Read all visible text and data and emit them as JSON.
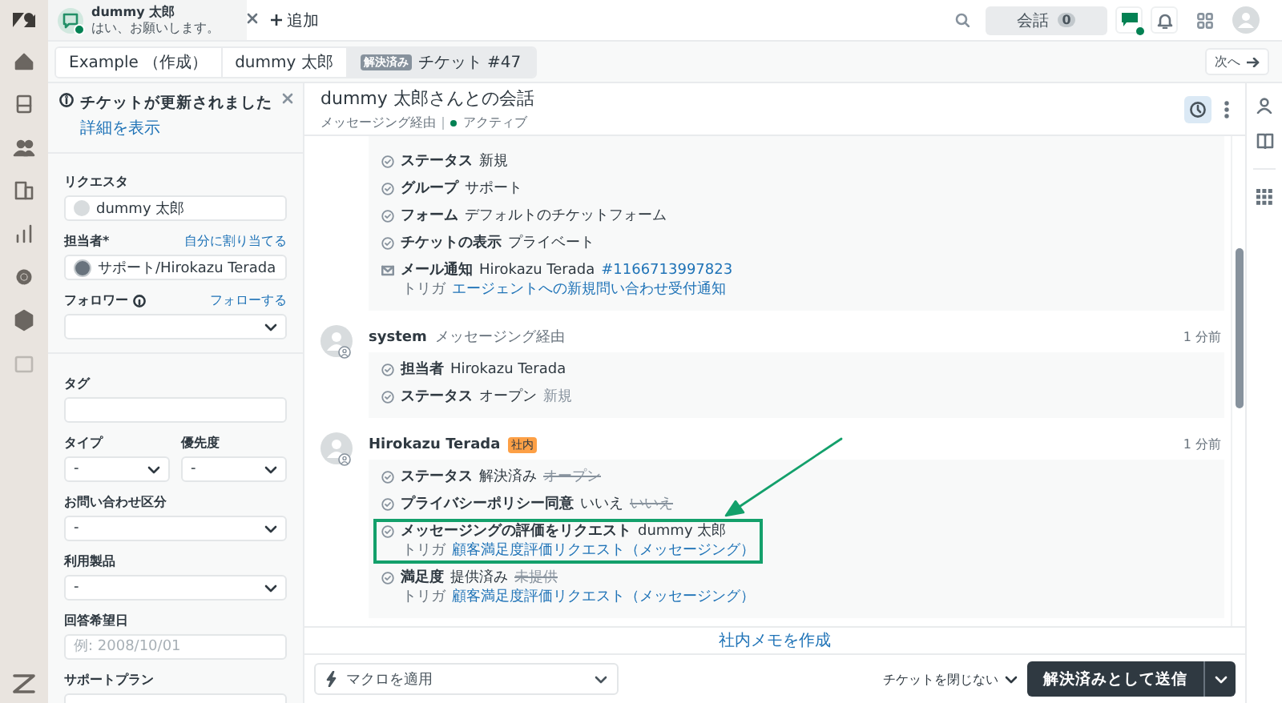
{
  "top_bar": {
    "tab": {
      "name": "dummy 太郎",
      "message": "はい、お願いします。",
      "online": true
    },
    "add_label": "追加",
    "conversations": {
      "label": "会話",
      "count": "0"
    },
    "messaging_online": true
  },
  "breadcrumbs": [
    {
      "label": "Example （作成）",
      "selected": false
    },
    {
      "label": "dummy 太郎",
      "selected": false
    },
    {
      "badge": "解決済み",
      "label": "チケット #47",
      "selected": true
    }
  ],
  "next_label": "次へ",
  "notification": {
    "title": "チケットが更新されました",
    "link": "詳細を表示"
  },
  "people_fields": [
    {
      "kind": "user",
      "label": "リクエスタ",
      "value": "dummy 太郎"
    },
    {
      "kind": "select",
      "label": "担当者*",
      "action": "自分に割り当てる",
      "value": "サポート/Hirokazu Terada",
      "avatar": true
    },
    {
      "kind": "select",
      "label": "フォロワー",
      "info": true,
      "action": "フォローする"
    }
  ],
  "ticket_fields": [
    {
      "kind": "text",
      "label": "タグ"
    },
    {
      "kind": "pair",
      "items": [
        {
          "kind": "select",
          "label": "タイプ",
          "value": "-"
        },
        {
          "kind": "select",
          "label": "優先度",
          "value": "-"
        }
      ]
    },
    {
      "kind": "select",
      "label": "お問い合わせ区分",
      "value": "-"
    },
    {
      "kind": "select",
      "label": "利用製品",
      "value": "-"
    },
    {
      "kind": "text",
      "label": "回答希望日",
      "placeholder": "例: 2008/10/01"
    },
    {
      "kind": "text",
      "label": "サポートプラン"
    }
  ],
  "conversation": {
    "title": "dummy 太郎さんとの会話",
    "channel": "メッセージング経由",
    "status": "アクティブ"
  },
  "events": [
    {
      "items": [
        {
          "kind": "change",
          "field": "ステータス",
          "value": "新規",
          "highlighted": false
        },
        {
          "kind": "change",
          "field": "グループ",
          "value": "サポート",
          "highlighted": false
        },
        {
          "kind": "change",
          "field": "フォーム",
          "value": "デフォルトのチケットフォーム",
          "highlighted": false
        },
        {
          "kind": "change",
          "field": "チケットの表示",
          "value": "プライベート",
          "highlighted": false
        },
        {
          "kind": "email",
          "field": "メール通知",
          "value": "Hirokazu Terada",
          "link": "#1166713997823",
          "trigger_label": "トリガ",
          "trigger": "エージェントへの新規問い合わせ受付通知",
          "highlighted": false
        }
      ]
    },
    {
      "author": "system",
      "via": "メッセージング経由",
      "time": "1 分前",
      "items": [
        {
          "kind": "change",
          "field": "担当者",
          "value": "Hirokazu Terada",
          "highlighted": false
        },
        {
          "kind": "change",
          "field": "ステータス",
          "value": "オープン",
          "old_value": "新規",
          "struck": false,
          "highlighted": false
        }
      ]
    },
    {
      "author": "Hirokazu Terada",
      "badge": "社内",
      "time": "1 分前",
      "items": [
        {
          "kind": "change",
          "field": "ステータス",
          "value": "解決済み",
          "old_value": "オープン",
          "struck": true,
          "highlighted": false
        },
        {
          "kind": "change",
          "field": "プライバシーポリシー同意",
          "value": "いいえ",
          "old_value": "いいえ",
          "struck": true,
          "highlighted": false
        },
        {
          "kind": "change",
          "field": "メッセージングの評価をリクエスト",
          "value": "dummy 太郎",
          "trigger_label": "トリガ",
          "trigger": "顧客満足度評価リクエスト（メッセージング）",
          "highlighted": true
        },
        {
          "kind": "change",
          "field": "満足度",
          "value": "提供済み",
          "old_value": "未提供",
          "struck": true,
          "trigger_label": "トリガ",
          "trigger": "顧客満足度評価リクエスト（メッセージング）",
          "highlighted": false
        }
      ]
    }
  ],
  "footer": {
    "note_link": "社内メモを作成",
    "macro_placeholder": "マクロを適用",
    "close_option": "チケットを閉じない",
    "submit": "解決済みとして送信"
  }
}
